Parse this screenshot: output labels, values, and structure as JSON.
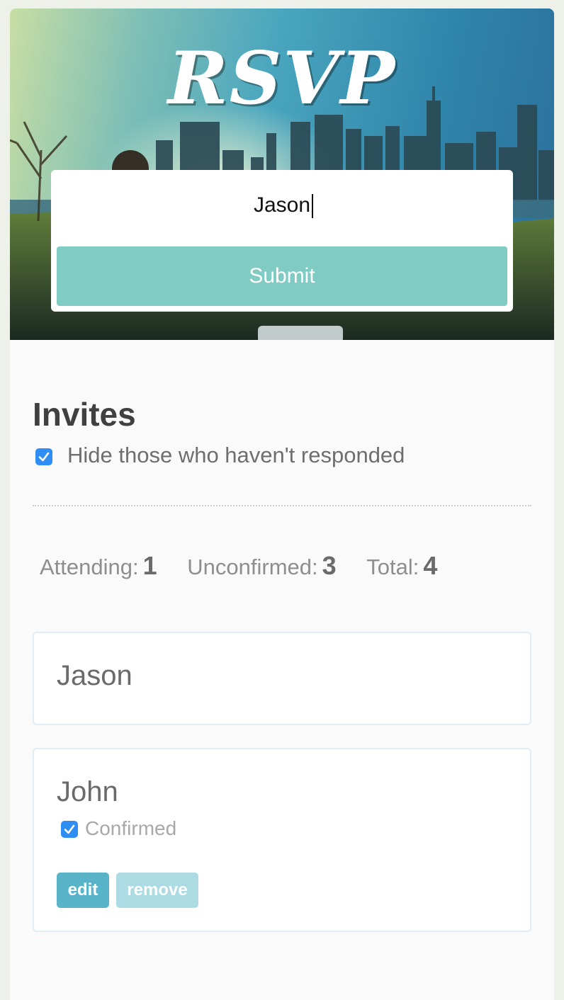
{
  "header": {
    "logo_text": "RSVP"
  },
  "form": {
    "name_value": "Jason",
    "submit_label": "Submit"
  },
  "invites": {
    "title": "Invites",
    "hide_label": "Hide those who haven't responded",
    "hide_checked": true
  },
  "stats": {
    "attending_label": "Attending:",
    "attending_value": "1",
    "unconfirmed_label": "Unconfirmed:",
    "unconfirmed_value": "3",
    "total_label": "Total:",
    "total_value": "4"
  },
  "guests": [
    {
      "name": "Jason"
    },
    {
      "name": "John",
      "confirmed_label": "Confirmed",
      "confirmed": true,
      "edit_label": "edit",
      "remove_label": "remove"
    }
  ],
  "colors": {
    "accent": "#80cbc4",
    "checkbox": "#2f8ef4",
    "edit": "#59b4ca",
    "remove": "#acdbe4"
  }
}
